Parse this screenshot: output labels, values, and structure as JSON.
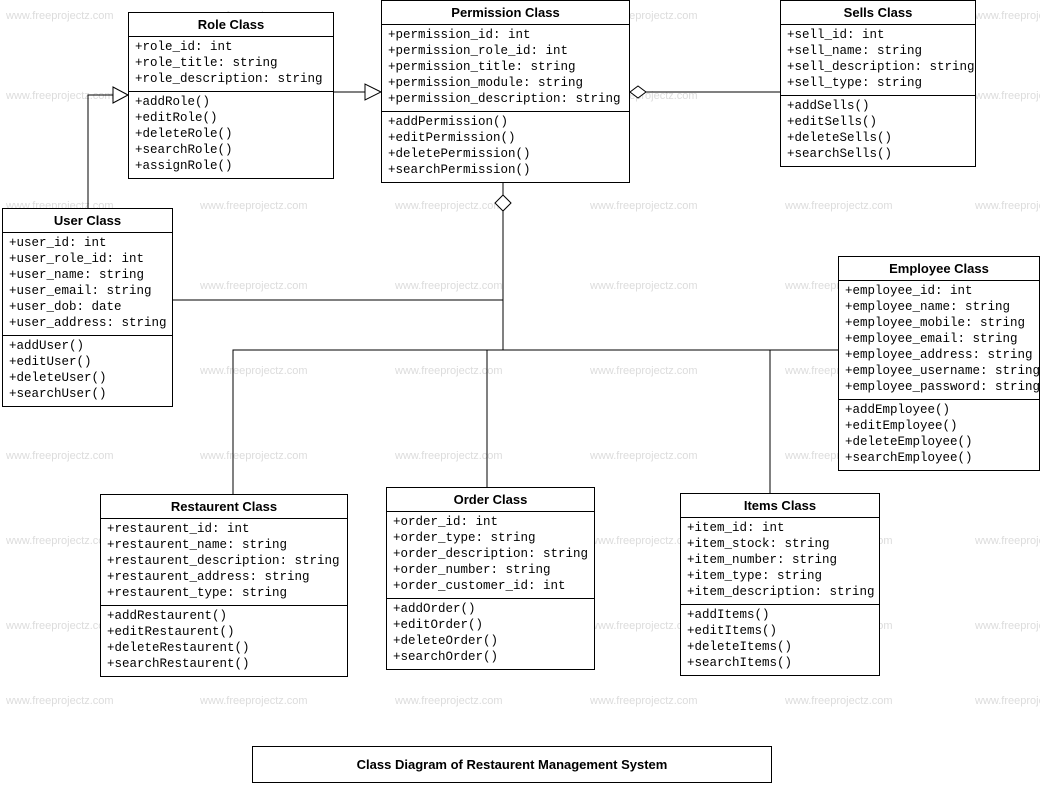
{
  "watermark_text": "www.freeprojectz.com",
  "diagram_title": "Class Diagram of Restaurent Management System",
  "classes": {
    "role": {
      "title": "Role Class",
      "attrs": [
        "+role_id: int",
        "+role_title: string",
        "+role_description: string"
      ],
      "ops": [
        "+addRole()",
        "+editRole()",
        "+deleteRole()",
        "+searchRole()",
        "+assignRole()"
      ]
    },
    "permission": {
      "title": "Permission Class",
      "attrs": [
        "+permission_id: int",
        "+permission_role_id: int",
        "+permission_title: string",
        "+permission_module: string",
        "+permission_description: string"
      ],
      "ops": [
        "+addPermission()",
        "+editPermission()",
        "+deletePermission()",
        "+searchPermission()"
      ]
    },
    "sells": {
      "title": "Sells Class",
      "attrs": [
        "+sell_id: int",
        "+sell_name: string",
        "+sell_description: string",
        "+sell_type: string"
      ],
      "ops": [
        "+addSells()",
        "+editSells()",
        "+deleteSells()",
        "+searchSells()"
      ]
    },
    "user": {
      "title": "User Class",
      "attrs": [
        "+user_id: int",
        "+user_role_id: int",
        "+user_name: string",
        "+user_email: string",
        "+user_dob: date",
        "+user_address: string"
      ],
      "ops": [
        "+addUser()",
        "+editUser()",
        "+deleteUser()",
        "+searchUser()"
      ]
    },
    "employee": {
      "title": "Employee Class",
      "attrs": [
        "+employee_id: int",
        "+employee_name: string",
        "+employee_mobile: string",
        "+employee_email: string",
        "+employee_address: string",
        "+employee_username: string",
        "+employee_password: string"
      ],
      "ops": [
        "+addEmployee()",
        "+editEmployee()",
        "+deleteEmployee()",
        "+searchEmployee()"
      ]
    },
    "restaurent": {
      "title": "Restaurent Class",
      "attrs": [
        "+restaurent_id: int",
        "+restaurent_name: string",
        "+restaurent_description: string",
        "+restaurent_address: string",
        "+restaurent_type: string"
      ],
      "ops": [
        "+addRestaurent()",
        "+editRestaurent()",
        "+deleteRestaurent()",
        "+searchRestaurent()"
      ]
    },
    "order": {
      "title": "Order Class",
      "attrs": [
        "+order_id: int",
        "+order_type: string",
        "+order_description: string",
        "+order_number: string",
        "+order_customer_id: int"
      ],
      "ops": [
        "+addOrder()",
        "+editOrder()",
        "+deleteOrder()",
        "+searchOrder()"
      ]
    },
    "items": {
      "title": "Items Class",
      "attrs": [
        "+item_id: int",
        "+item_stock: string",
        "+item_number: string",
        "+item_type: string",
        "+item_description: string"
      ],
      "ops": [
        "+addItems()",
        "+editItems()",
        "+deleteItems()",
        "+searchItems()"
      ]
    }
  }
}
